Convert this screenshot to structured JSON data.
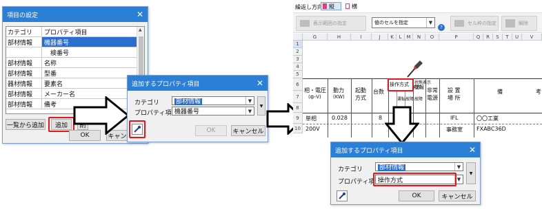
{
  "settings_dialog": {
    "title": "項目の設定",
    "col_category": "カテゴリ",
    "col_property": "プロパティ項目",
    "rows": [
      {
        "category": "部材情報",
        "property": "機器番号",
        "selected": true
      },
      {
        "category": "",
        "property": "検番号",
        "selected": false
      },
      {
        "category": "部材情報",
        "property": "名称",
        "selected": false
      },
      {
        "category": "部材情報",
        "property": "型番",
        "selected": false
      },
      {
        "category": "器材情報",
        "property": "要素名",
        "selected": false
      },
      {
        "category": "部材情報",
        "property": "メーカー名",
        "selected": false
      },
      {
        "category": "部材情報",
        "property": "備考",
        "selected": false
      }
    ],
    "add_from_list_label": "一覧から追加",
    "add_label": "追加",
    "cut_label": "削",
    "ok_label": "OK",
    "cancel_label": "キャンセル"
  },
  "add_dialog_1": {
    "title": "追加するプロパティ項目",
    "category_label": "カテゴリ",
    "category_value": "部材情報",
    "property_label": "プロパティ項目",
    "property_value": "機器番号",
    "ok_label": "OK",
    "cancel_label": "キャンセル"
  },
  "add_dialog_2": {
    "title": "追加するプロパティ項目",
    "category_label": "カテゴリ",
    "category_value": "部材情報",
    "property_label": "プロパティ項目",
    "property_value": "操作方式",
    "ok_label": "OK",
    "cancel_label": "キャンセル"
  },
  "spreadsheet": {
    "direction_label": "繰返し方向",
    "direction_vertical": "縦",
    "direction_horizontal": "横",
    "toolbar_btn1": "表示範囲の指定",
    "cell_value_dropdown": "値のセルを指定",
    "toolbar_btn2": "セル枠の指定",
    "toolbar_btn3": "解除",
    "columns": [
      "G",
      "H",
      "I",
      "J",
      "K",
      "L",
      "M",
      "N",
      "O",
      "P",
      "Q",
      "R",
      "S",
      "T",
      "U",
      "V"
    ],
    "rows": [
      "1",
      "2",
      "3",
      "4",
      "5",
      "6",
      "7",
      "8",
      "9",
      "10"
    ],
    "header_phase": "相・電圧",
    "header_phase_unit": "(ф-V)",
    "header_power": "動力",
    "header_power_unit": "(KW)",
    "header_start": "起動",
    "header_start2": "方式",
    "header_count": "台数",
    "header_operation": "操作方式",
    "header_manual": "操作方",
    "header_state": "運転",
    "header_fault": "故障",
    "header_interlock": "故障",
    "header_emergency": "非常",
    "header_emergency2": "電源",
    "header_location": "設 置",
    "header_location2": "場 所",
    "header_remarks": "備",
    "header_remarks2": "考",
    "header_status": "状態表示",
    "header_heater": "警報",
    "row9_phase": "単相",
    "row9_power": "0.028",
    "row9_count": "8",
    "row9_location": "IFL",
    "row9_remarks": "〇〇工業",
    "row10_voltage": "200V",
    "row10_location": "事務室",
    "row10_remarks": "FXABC36D"
  }
}
